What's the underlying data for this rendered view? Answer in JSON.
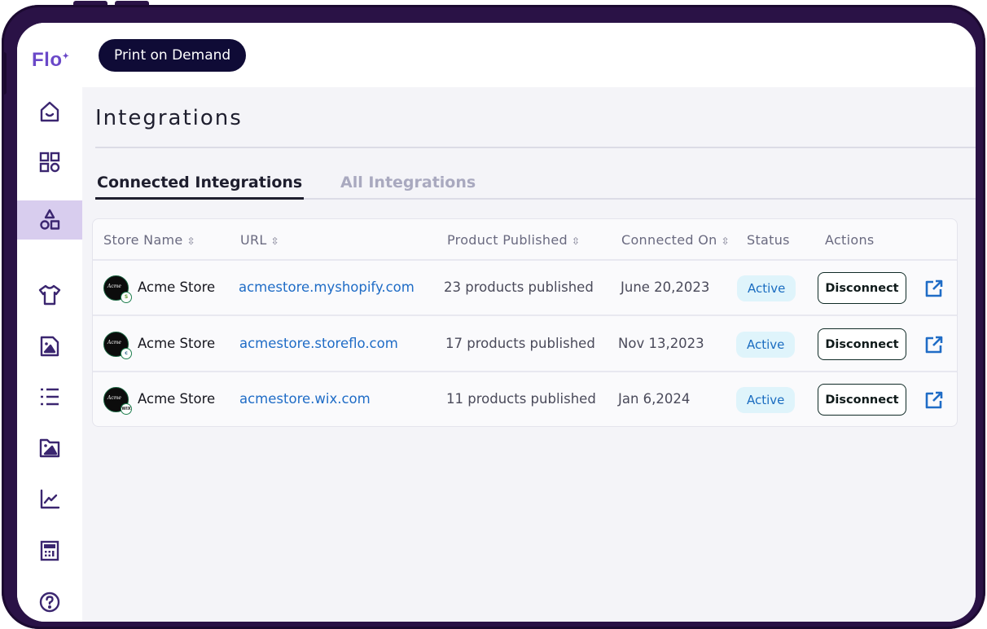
{
  "app": {
    "logo": "Flo",
    "workspace_button": "Print on Demand"
  },
  "sidebar": {
    "items": [
      {
        "name": "home",
        "icon": "home-icon",
        "active": false
      },
      {
        "name": "dashboard",
        "icon": "grid-icon",
        "active": false
      },
      {
        "name": "integrations",
        "icon": "shapes-icon",
        "active": true
      },
      {
        "name": "products",
        "icon": "tshirt-icon",
        "active": false
      },
      {
        "name": "designs",
        "icon": "image-file-icon",
        "active": false
      },
      {
        "name": "orders",
        "icon": "list-icon",
        "active": false
      },
      {
        "name": "media",
        "icon": "folder-image-icon",
        "active": false
      },
      {
        "name": "analytics",
        "icon": "chart-icon",
        "active": false
      },
      {
        "name": "calculator",
        "icon": "calculator-icon",
        "active": false
      },
      {
        "name": "help",
        "icon": "help-icon",
        "active": false
      }
    ]
  },
  "page": {
    "title": "Integrations",
    "tabs": [
      {
        "label": "Connected Integrations",
        "active": true
      },
      {
        "label": "All Integrations",
        "active": false
      }
    ]
  },
  "table": {
    "columns": [
      "Store Name",
      "URL",
      "Product Published",
      "Connected On",
      "Status",
      "Actions"
    ],
    "rows": [
      {
        "store": "Acme Store",
        "platform_badge": "S",
        "platform": "shopify",
        "url": "acmestore.myshopify.com",
        "products": "23 products published",
        "connected_on": "June 20,2023",
        "status": "Active",
        "action": "Disconnect"
      },
      {
        "store": "Acme Store",
        "platform_badge": "c",
        "platform": "storeflo",
        "url": "acmestore.storeflo.com",
        "products": "17 products published",
        "connected_on": "Nov 13,2023",
        "status": "Active",
        "action": "Disconnect"
      },
      {
        "store": "Acme Store",
        "platform_badge": "WIX",
        "platform": "wix",
        "url": "acmestore.wix.com",
        "products": "11 products published",
        "connected_on": "Jan 6,2024",
        "status": "Active",
        "action": "Disconnect"
      }
    ],
    "avatar_text": "Acme"
  },
  "colors": {
    "brand": "#6a48c8",
    "frame": "#2a1246",
    "active_nav": "#d8cdee",
    "link": "#1f6cc6",
    "status_bg": "#dff4fb"
  }
}
